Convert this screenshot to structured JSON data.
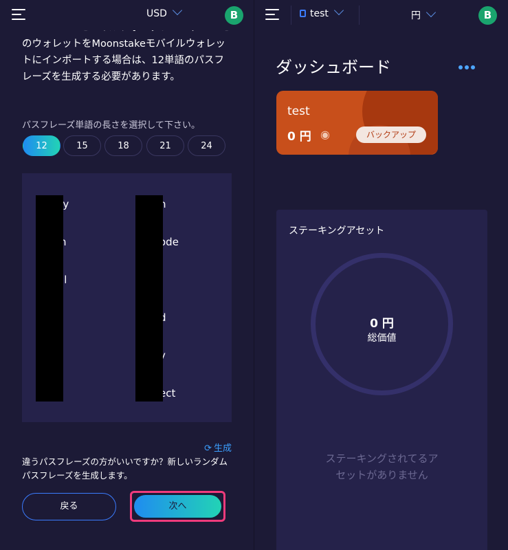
{
  "left": {
    "topbar": {
      "currency": "USD",
      "avatar": "B"
    },
    "description": "Moonstake モバイルウォレットユーザー： このウォレットをMoonstakeモバイルウォレットにインポートする場合は、12単語のパスフレーズを生成する必要があります。",
    "length_label": "パスフレーズ単語の長さを選択して下さい。",
    "length_options": [
      "12",
      "15",
      "18",
      "21",
      "24"
    ],
    "selected_length": "12",
    "words": [
      {
        "text": "oly"
      },
      {
        "text": "n"
      },
      {
        "text": "n"
      },
      {
        "text": "ode"
      },
      {
        "text": "al"
      },
      {
        "text": ""
      },
      {
        "text": ""
      },
      {
        "text": "d"
      },
      {
        "text": "y"
      },
      {
        "text": "y"
      },
      {
        "text": "r"
      },
      {
        "text": "ect"
      }
    ],
    "regenerate_label": "生成",
    "hint": "違うパスフレーズの方がいいですか？新しいランダムパスフレーズを生成します。",
    "back_label": "戻る",
    "next_label": "次へ"
  },
  "right": {
    "topbar": {
      "wallet": "test",
      "currency": "円",
      "avatar": "B"
    },
    "title": "ダッシュボード",
    "wallet_card": {
      "name": "test",
      "balance": "0 円",
      "backup_label": "バックアップ"
    },
    "staking": {
      "title": "ステーキングアセット",
      "total_value": "0 円",
      "total_label": "総価値",
      "empty_message": "ステーキングされてるアセットがありません"
    }
  }
}
